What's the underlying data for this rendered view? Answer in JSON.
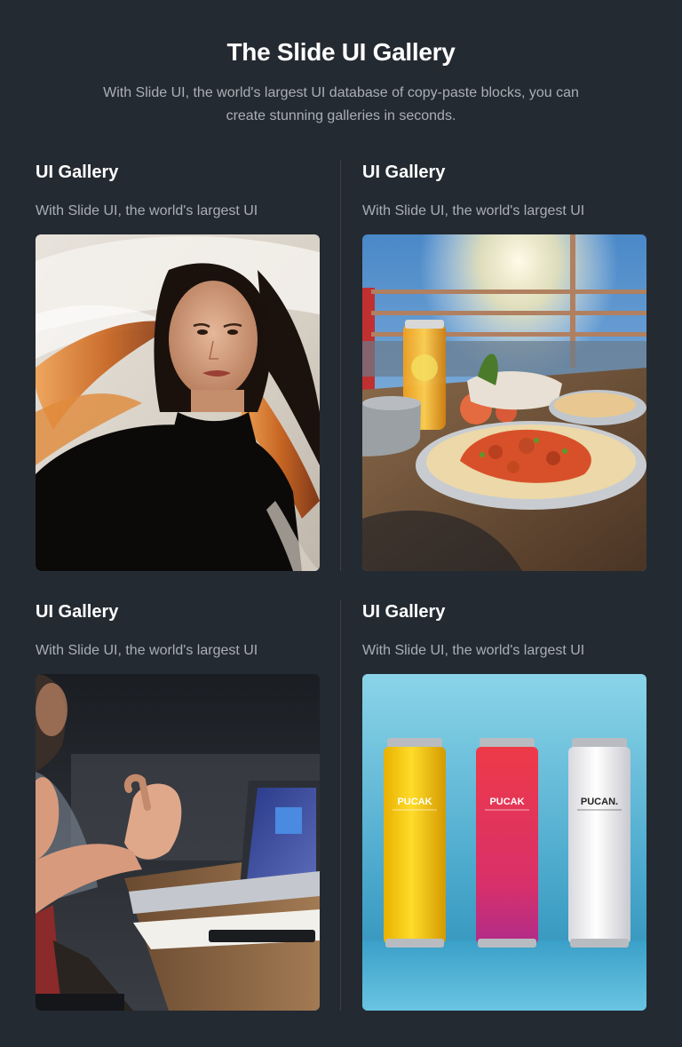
{
  "header": {
    "title": "The Slide UI Gallery",
    "subtitle": "With Slide UI, the world's largest UI database of copy-paste blocks, you can create stunning galleries in seconds."
  },
  "cards": [
    {
      "title": "UI Gallery",
      "text": "With Slide UI, the world's largest UI",
      "image": "woman-portrait-wind-photo"
    },
    {
      "title": "UI Gallery",
      "text": "With Slide UI, the world's largest UI",
      "image": "food-table-terrace-photo"
    },
    {
      "title": "UI Gallery",
      "text": "With Slide UI, the world's largest UI",
      "image": "meeting-laptop-hands-photo"
    },
    {
      "title": "UI Gallery",
      "text": "With Slide UI, the world's largest UI",
      "image": "three-cans-blue-photo"
    }
  ],
  "cans": [
    "PUCAK",
    "PUCAK",
    "PUCAN."
  ],
  "colors": {
    "background": "#242a31",
    "title": "#ffffff",
    "muted_text": "#a9afb6",
    "divider": "#3a414a"
  }
}
